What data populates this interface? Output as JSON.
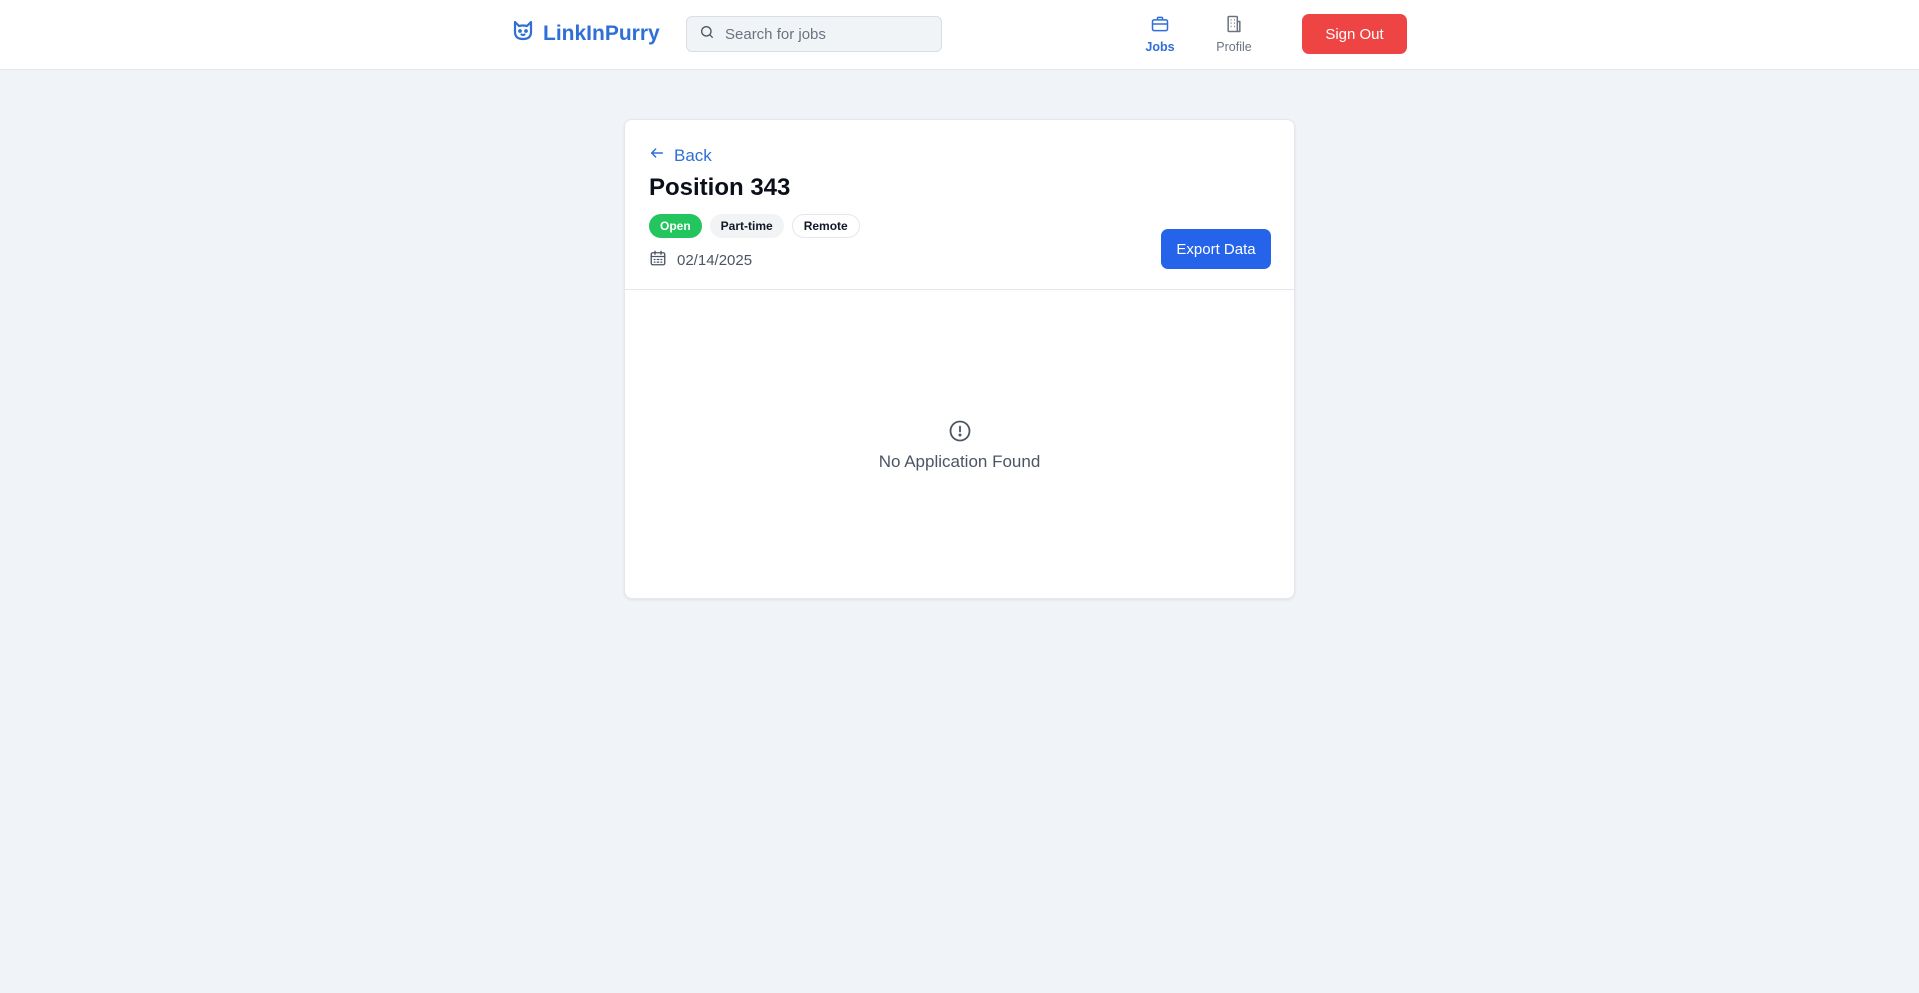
{
  "app": {
    "name": "LinkInPurry",
    "logo_icon": "cat-icon",
    "accent_color": "#2f6fd6"
  },
  "search": {
    "placeholder": "Search for jobs",
    "value": ""
  },
  "nav": {
    "items": [
      {
        "label": "Jobs",
        "icon": "briefcase-icon",
        "active": true
      },
      {
        "label": "Profile",
        "icon": "building-icon",
        "active": false
      }
    ],
    "sign_out_label": "Sign Out",
    "sign_out_color": "#ef4444"
  },
  "job": {
    "back_label": "Back",
    "title": "Position 343",
    "badges": [
      {
        "label": "Open",
        "color": "#22c55e"
      },
      {
        "label": "Part-time"
      },
      {
        "label": "Remote"
      }
    ],
    "date": "02/14/2025",
    "export_label": "Export Data",
    "export_color": "#2563eb"
  },
  "applications": {
    "empty_icon": "alert-circle-icon",
    "empty_message": "No Application Found"
  }
}
